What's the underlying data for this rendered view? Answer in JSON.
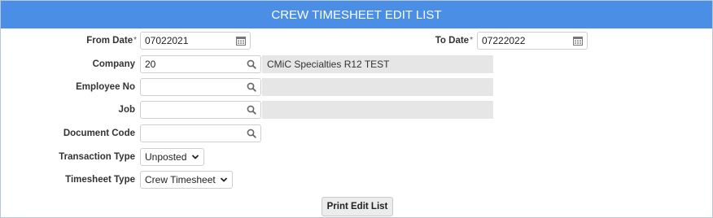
{
  "header": {
    "title": "CREW TIMESHEET EDIT LIST"
  },
  "form": {
    "from_date": {
      "label": "From Date",
      "required_mark": "*",
      "value": "07022021",
      "icon": "calendar-icon"
    },
    "to_date": {
      "label": "To Date",
      "required_mark": "*",
      "value": "07222022",
      "icon": "calendar-icon"
    },
    "company": {
      "label": "Company",
      "value": "20",
      "description": "CMiC Specialties R12 TEST",
      "icon": "search-icon"
    },
    "employee_no": {
      "label": "Employee No",
      "value": "",
      "description": "",
      "icon": "search-icon"
    },
    "job": {
      "label": "Job",
      "value": "",
      "description": "",
      "icon": "search-icon"
    },
    "document_code": {
      "label": "Document Code",
      "value": "",
      "icon": "search-icon"
    },
    "transaction_type": {
      "label": "Transaction Type",
      "selected": "Unposted"
    },
    "timesheet_type": {
      "label": "Timesheet Type",
      "selected": "Crew Timesheet"
    }
  },
  "actions": {
    "print_label": "Print Edit List"
  }
}
